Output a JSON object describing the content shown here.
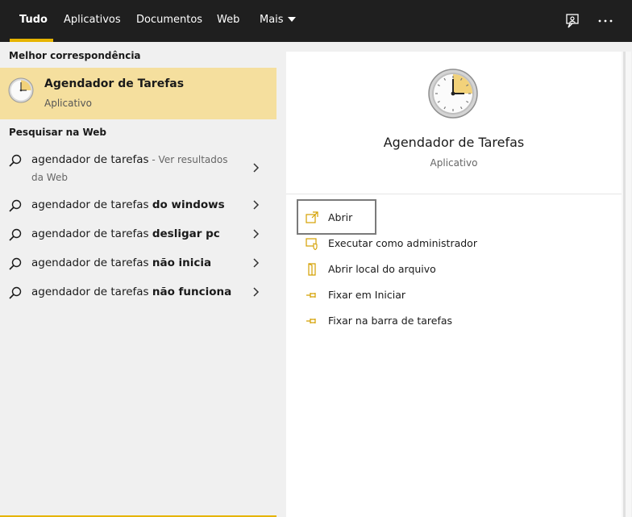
{
  "tabs": [
    {
      "label": "Tudo"
    },
    {
      "label": "Aplicativos"
    },
    {
      "label": "Documentos"
    },
    {
      "label": "Web"
    },
    {
      "label": "Mais"
    }
  ],
  "left": {
    "best_match_title": "Melhor correspondência",
    "best_match": {
      "title": "Agendador de Tarefas",
      "subtitle": "Aplicativo"
    },
    "web_title": "Pesquisar na Web",
    "web_items": [
      {
        "query": "agendador de tarefas",
        "bold": "",
        "suffix": " - Ver resultados",
        "line2": "da Web"
      },
      {
        "query": "agendador de tarefas ",
        "bold": "do windows"
      },
      {
        "query": "agendador de tarefas ",
        "bold": "desligar pc"
      },
      {
        "query": "agendador de tarefas ",
        "bold": "não inicia"
      },
      {
        "query": "agendador de tarefas ",
        "bold": "não funciona"
      }
    ]
  },
  "right": {
    "title": "Agendador de Tarefas",
    "subtitle": "Aplicativo",
    "actions": [
      {
        "label": "Abrir",
        "icon": "open-icon"
      },
      {
        "label": "Executar como administrador",
        "icon": "run-as-admin-icon"
      },
      {
        "label": "Abrir local do arquivo",
        "icon": "file-location-icon"
      },
      {
        "label": "Fixar em Iniciar",
        "icon": "pin-icon"
      },
      {
        "label": "Fixar na barra de tarefas",
        "icon": "pin-icon"
      }
    ]
  },
  "colors": {
    "accent": "#e6b400",
    "selection": "#f5df9e",
    "topbar": "#1f1f1f"
  }
}
